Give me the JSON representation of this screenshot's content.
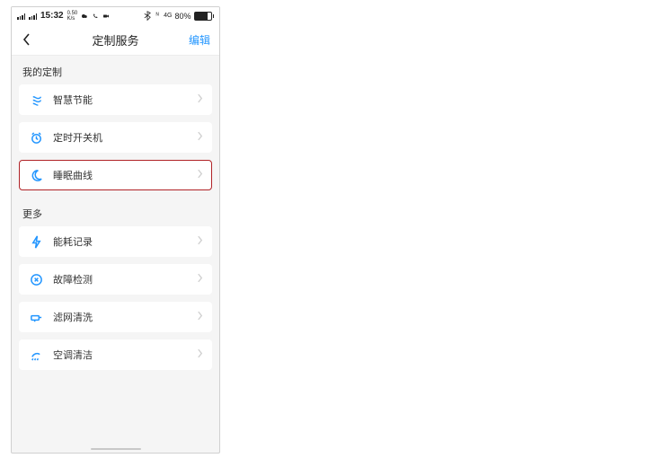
{
  "status": {
    "time": "15:32",
    "sub1": "0.50",
    "sub2": "K/s",
    "bt_label": "BT",
    "net_label": "4G",
    "battery_pct": "80%"
  },
  "nav": {
    "title": "定制服务",
    "edit": "编辑"
  },
  "sections": {
    "my": "我的定制",
    "more": "更多",
    "items_my": {
      "energy": "智慧节能",
      "timer": "定时开关机",
      "sleep": "睡眠曲线"
    },
    "items_more": {
      "consumption": "能耗记录",
      "fault": "故障检测",
      "filter": "滤网清洗",
      "clean": "空调清洁"
    }
  }
}
